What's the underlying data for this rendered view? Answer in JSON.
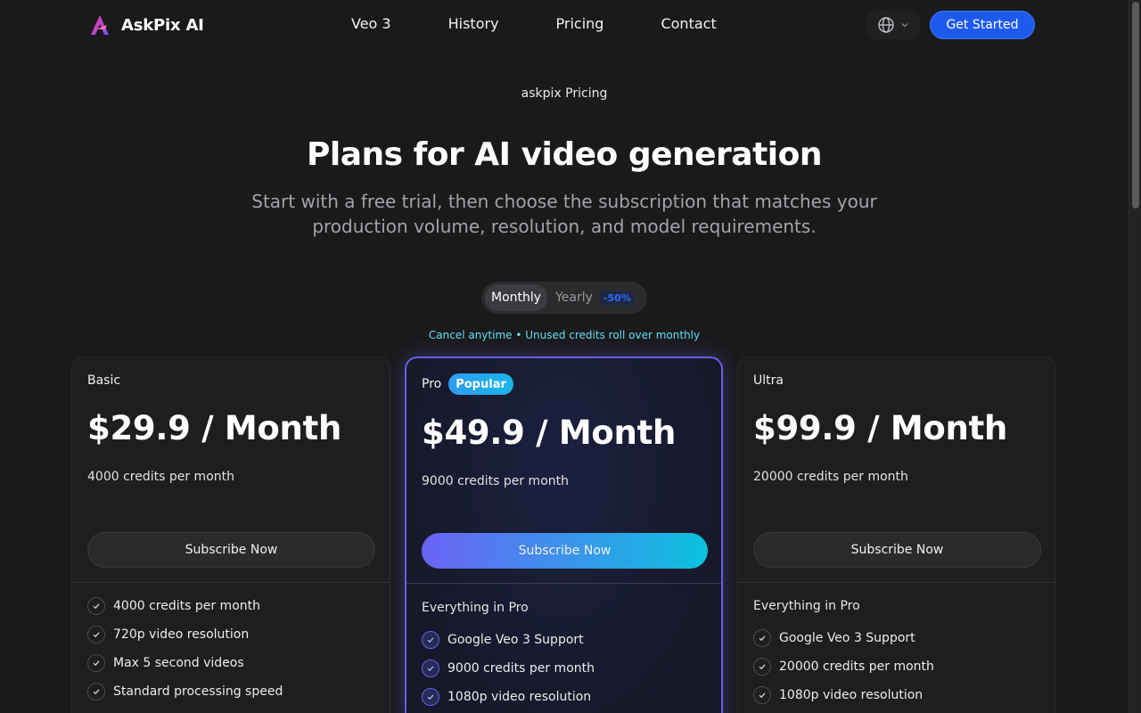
{
  "header": {
    "brand": "AskPix AI",
    "nav": [
      "Veo 3",
      "History",
      "Pricing",
      "Contact"
    ],
    "language_icon": "globe-icon",
    "cta": "Get Started"
  },
  "hero": {
    "eyebrow": "askpix Pricing",
    "title": "Plans for AI video generation",
    "subtitle": "Start with a free trial, then choose the subscription that matches your production volume, resolution, and model requirements."
  },
  "billing_toggle": {
    "monthly": "Monthly",
    "yearly": "Yearly",
    "discount": "-50%",
    "selected": "Monthly"
  },
  "note": "Cancel anytime • Unused credits roll over monthly",
  "plans": [
    {
      "name": "Basic",
      "price": "$29.9 / Month",
      "credits": "4000 credits per month",
      "button": "Subscribe Now",
      "features_heading": "",
      "features": [
        "4000 credits per month",
        "720p video resolution",
        "Max 5 second videos",
        "Standard processing speed"
      ]
    },
    {
      "name": "Pro",
      "badge": "Popular",
      "price": "$49.9 / Month",
      "credits": "9000 credits per month",
      "button": "Subscribe Now",
      "features_heading": "Everything in Pro",
      "features": [
        "Google Veo 3 Support",
        "9000 credits per month",
        "1080p video resolution"
      ]
    },
    {
      "name": "Ultra",
      "price": "$99.9 / Month",
      "credits": "20000 credits per month",
      "button": "Subscribe Now",
      "features_heading": "Everything in Pro",
      "features": [
        "Google Veo 3 Support",
        "20000 credits per month",
        "1080p video resolution"
      ]
    }
  ],
  "colors": {
    "background": "#1a1a1c",
    "primary": "#1d5bf0",
    "accent_cyan": "#5ee0f0",
    "pro_border": "#6b5ce7"
  }
}
